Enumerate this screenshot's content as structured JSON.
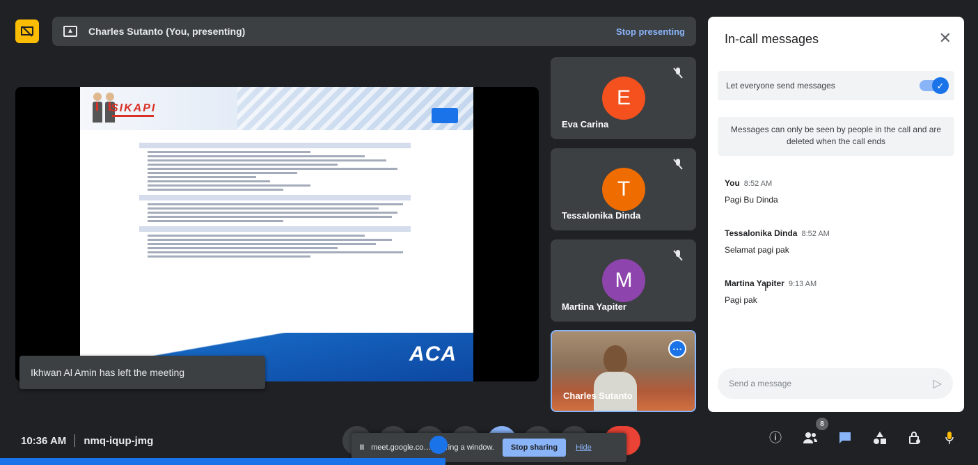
{
  "presenting": {
    "title": "Charles Sutanto (You, presenting)",
    "stop_label": "Stop presenting"
  },
  "toast": "Ikhwan Al Amin has left the meeting",
  "participants": [
    {
      "name": "Eva Carina",
      "initial": "E",
      "color": "#f4511e"
    },
    {
      "name": "Tessalonika Dinda",
      "initial": "T",
      "color": "#ef6c00"
    },
    {
      "name": "Martina Yapiter",
      "initial": "M",
      "color": "#8e44ad"
    },
    {
      "name": "Charles Sutanto",
      "initial": "",
      "color": ""
    }
  ],
  "panel": {
    "title": "In-call messages",
    "toggle_label": "Let everyone send messages",
    "toggle_on": true,
    "notice": "Messages can only be seen by people in the call and are deleted when the call ends",
    "messages": [
      {
        "sender": "You",
        "time": "8:52 AM",
        "text": "Pagi Bu Dinda"
      },
      {
        "sender": "Tessalonika Dinda",
        "time": "8:52 AM",
        "text": "Selamat pagi pak"
      },
      {
        "sender": "Martina Yapiter",
        "time": "9:13 AM",
        "text": "Pagi pak"
      }
    ],
    "input_placeholder": "Send a message"
  },
  "bottom": {
    "time": "10:36 AM",
    "meeting_code": "nmq-iqup-jmg",
    "participant_count": "8"
  },
  "share_popup": {
    "pause_label": "II",
    "text": "meet.google.co… sharing a window.",
    "stop_label": "Stop sharing",
    "hide_label": "Hide"
  },
  "slide": {
    "logo_text": "SIKAPI",
    "footer_text": "ACA"
  },
  "colors": {
    "accent": "#1a73e8",
    "end_call": "#ea4335",
    "present_badge": "#fbbc04"
  }
}
